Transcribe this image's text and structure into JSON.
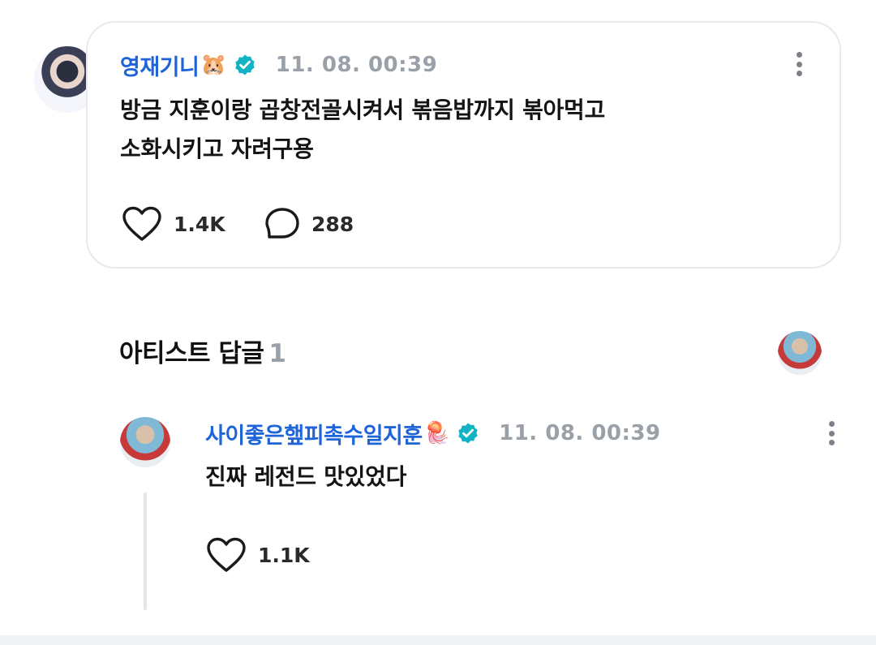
{
  "post": {
    "author": "영재기니",
    "author_emoji": "🐹",
    "time": "11. 08. 00:39",
    "body_line1": "방금 지훈이랑 곱창전골시켜서 볶음밥까지 볶아먹고",
    "body_line2": "소화시키고 자려구용",
    "likes": "1.4K",
    "comments": "288"
  },
  "artist_replies": {
    "title": "아티스트 답글",
    "count": "1"
  },
  "reply": {
    "author": "사이좋은햎피촉수일지훈",
    "author_emoji": "🪼",
    "time": "11. 08. 00:39",
    "body": "진짜 레전드 맛있었다",
    "likes": "1.1K"
  },
  "colors": {
    "author_name": "#1e64d8",
    "verified_badge": "#12b3c4",
    "muted": "#9aa0a8",
    "card_border": "#e7e9ee"
  },
  "icons": [
    "verified-badge-icon",
    "more-vertical-icon",
    "heart-icon",
    "comment-bubble-icon"
  ]
}
